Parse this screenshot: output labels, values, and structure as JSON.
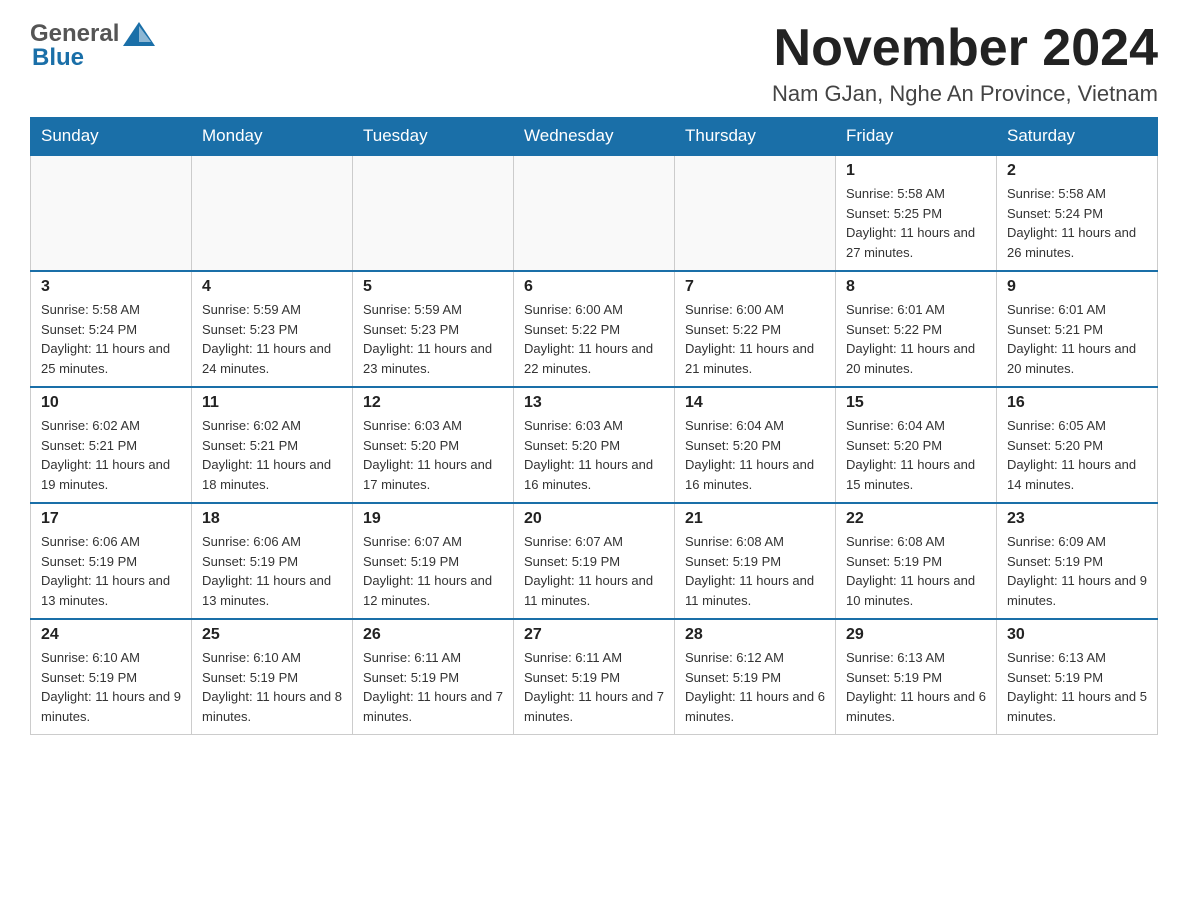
{
  "header": {
    "logo_general": "General",
    "logo_blue": "Blue",
    "month_title": "November 2024",
    "location": "Nam GJan, Nghe An Province, Vietnam"
  },
  "weekdays": [
    "Sunday",
    "Monday",
    "Tuesday",
    "Wednesday",
    "Thursday",
    "Friday",
    "Saturday"
  ],
  "weeks": [
    [
      {
        "day": "",
        "info": ""
      },
      {
        "day": "",
        "info": ""
      },
      {
        "day": "",
        "info": ""
      },
      {
        "day": "",
        "info": ""
      },
      {
        "day": "",
        "info": ""
      },
      {
        "day": "1",
        "info": "Sunrise: 5:58 AM\nSunset: 5:25 PM\nDaylight: 11 hours and 27 minutes."
      },
      {
        "day": "2",
        "info": "Sunrise: 5:58 AM\nSunset: 5:24 PM\nDaylight: 11 hours and 26 minutes."
      }
    ],
    [
      {
        "day": "3",
        "info": "Sunrise: 5:58 AM\nSunset: 5:24 PM\nDaylight: 11 hours and 25 minutes."
      },
      {
        "day": "4",
        "info": "Sunrise: 5:59 AM\nSunset: 5:23 PM\nDaylight: 11 hours and 24 minutes."
      },
      {
        "day": "5",
        "info": "Sunrise: 5:59 AM\nSunset: 5:23 PM\nDaylight: 11 hours and 23 minutes."
      },
      {
        "day": "6",
        "info": "Sunrise: 6:00 AM\nSunset: 5:22 PM\nDaylight: 11 hours and 22 minutes."
      },
      {
        "day": "7",
        "info": "Sunrise: 6:00 AM\nSunset: 5:22 PM\nDaylight: 11 hours and 21 minutes."
      },
      {
        "day": "8",
        "info": "Sunrise: 6:01 AM\nSunset: 5:22 PM\nDaylight: 11 hours and 20 minutes."
      },
      {
        "day": "9",
        "info": "Sunrise: 6:01 AM\nSunset: 5:21 PM\nDaylight: 11 hours and 20 minutes."
      }
    ],
    [
      {
        "day": "10",
        "info": "Sunrise: 6:02 AM\nSunset: 5:21 PM\nDaylight: 11 hours and 19 minutes."
      },
      {
        "day": "11",
        "info": "Sunrise: 6:02 AM\nSunset: 5:21 PM\nDaylight: 11 hours and 18 minutes."
      },
      {
        "day": "12",
        "info": "Sunrise: 6:03 AM\nSunset: 5:20 PM\nDaylight: 11 hours and 17 minutes."
      },
      {
        "day": "13",
        "info": "Sunrise: 6:03 AM\nSunset: 5:20 PM\nDaylight: 11 hours and 16 minutes."
      },
      {
        "day": "14",
        "info": "Sunrise: 6:04 AM\nSunset: 5:20 PM\nDaylight: 11 hours and 16 minutes."
      },
      {
        "day": "15",
        "info": "Sunrise: 6:04 AM\nSunset: 5:20 PM\nDaylight: 11 hours and 15 minutes."
      },
      {
        "day": "16",
        "info": "Sunrise: 6:05 AM\nSunset: 5:20 PM\nDaylight: 11 hours and 14 minutes."
      }
    ],
    [
      {
        "day": "17",
        "info": "Sunrise: 6:06 AM\nSunset: 5:19 PM\nDaylight: 11 hours and 13 minutes."
      },
      {
        "day": "18",
        "info": "Sunrise: 6:06 AM\nSunset: 5:19 PM\nDaylight: 11 hours and 13 minutes."
      },
      {
        "day": "19",
        "info": "Sunrise: 6:07 AM\nSunset: 5:19 PM\nDaylight: 11 hours and 12 minutes."
      },
      {
        "day": "20",
        "info": "Sunrise: 6:07 AM\nSunset: 5:19 PM\nDaylight: 11 hours and 11 minutes."
      },
      {
        "day": "21",
        "info": "Sunrise: 6:08 AM\nSunset: 5:19 PM\nDaylight: 11 hours and 11 minutes."
      },
      {
        "day": "22",
        "info": "Sunrise: 6:08 AM\nSunset: 5:19 PM\nDaylight: 11 hours and 10 minutes."
      },
      {
        "day": "23",
        "info": "Sunrise: 6:09 AM\nSunset: 5:19 PM\nDaylight: 11 hours and 9 minutes."
      }
    ],
    [
      {
        "day": "24",
        "info": "Sunrise: 6:10 AM\nSunset: 5:19 PM\nDaylight: 11 hours and 9 minutes."
      },
      {
        "day": "25",
        "info": "Sunrise: 6:10 AM\nSunset: 5:19 PM\nDaylight: 11 hours and 8 minutes."
      },
      {
        "day": "26",
        "info": "Sunrise: 6:11 AM\nSunset: 5:19 PM\nDaylight: 11 hours and 7 minutes."
      },
      {
        "day": "27",
        "info": "Sunrise: 6:11 AM\nSunset: 5:19 PM\nDaylight: 11 hours and 7 minutes."
      },
      {
        "day": "28",
        "info": "Sunrise: 6:12 AM\nSunset: 5:19 PM\nDaylight: 11 hours and 6 minutes."
      },
      {
        "day": "29",
        "info": "Sunrise: 6:13 AM\nSunset: 5:19 PM\nDaylight: 11 hours and 6 minutes."
      },
      {
        "day": "30",
        "info": "Sunrise: 6:13 AM\nSunset: 5:19 PM\nDaylight: 11 hours and 5 minutes."
      }
    ]
  ]
}
